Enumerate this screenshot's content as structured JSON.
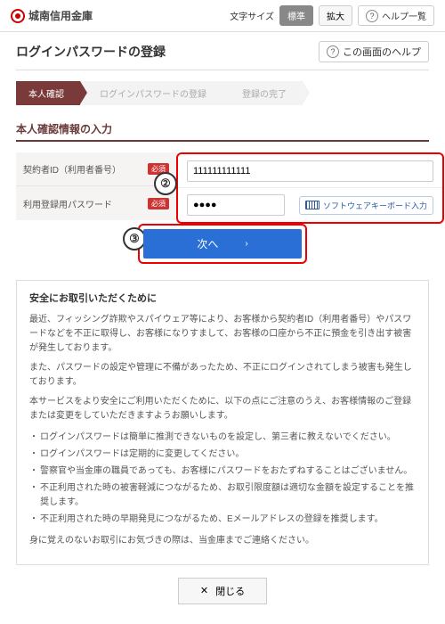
{
  "header": {
    "brand": "城南信用金庫",
    "font_size_label": "文字サイズ",
    "size_standard": "標準",
    "size_large": "拡大",
    "help_list": "ヘルプ一覧"
  },
  "page": {
    "title": "ログインパスワードの登録",
    "page_help": "この画面のヘルプ"
  },
  "steps": {
    "s1": "本人確認",
    "s2": "ログインパスワードの登録",
    "s3": "登録の完了"
  },
  "section_title": "本人確認情報の入力",
  "form": {
    "row1_label": "契約者ID（利用者番号）",
    "row1_value": "111111111111",
    "row2_label": "利用登録用パスワード",
    "row2_value": "●●●●",
    "required": "必須",
    "soft_keyboard": "ソフトウェアキーボード入力"
  },
  "callouts": {
    "c2": "②",
    "c3": "③"
  },
  "next_label": "次へ",
  "notice": {
    "title": "安全にお取引いただくために",
    "p1": "最近、フィッシング詐欺やスパイウェア等により、お客様から契約者ID（利用者番号）やパスワードなどを不正に取得し、お客様になりすまして、お客様の口座から不正に預金を引き出す被害が発生しております。",
    "p2": "また、パスワードの設定や管理に不備があったため、不正にログインされてしまう被害も発生しております。",
    "p3": "本サービスをより安全にご利用いただくために、以下の点にご注意のうえ、お客様情報のご登録または変更をしていただきますようお願いします。",
    "li1": "ログインパスワードは簡単に推測できないものを設定し、第三者に教えないでください。",
    "li2": "ログインパスワードは定期的に変更してください。",
    "li3": "警察官や当金庫の職員であっても、お客様にパスワードをおたずねすることはございません。",
    "li4": "不正利用された時の被害軽減につながるため、お取引限度額は適切な金額を設定することを推奨します。",
    "li5": "不正利用された時の早期発見につながるため、Eメールアドレスの登録を推奨します。",
    "p4": "身に覚えのないお取引にお気づきの際は、当金庫までご連絡ください。"
  },
  "close_label": "閉じる"
}
